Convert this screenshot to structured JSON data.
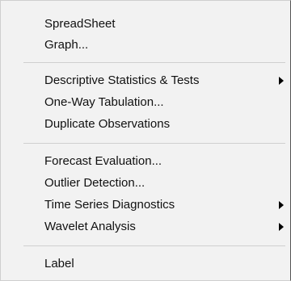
{
  "menu": {
    "groups": [
      {
        "items": [
          {
            "label": "SpreadSheet"
          },
          {
            "label": "Graph..."
          }
        ]
      },
      {
        "items": [
          {
            "label": "Descriptive Statistics & Tests",
            "submenu": true
          },
          {
            "label": "One-Way Tabulation..."
          },
          {
            "label": "Duplicate Observations"
          }
        ]
      },
      {
        "items": [
          {
            "label": "Forecast Evaluation..."
          },
          {
            "label": "Outlier Detection..."
          },
          {
            "label": "Time Series Diagnostics",
            "submenu": true
          },
          {
            "label": "Wavelet Analysis",
            "submenu": true
          }
        ]
      },
      {
        "items": [
          {
            "label": "Label"
          }
        ]
      }
    ]
  }
}
